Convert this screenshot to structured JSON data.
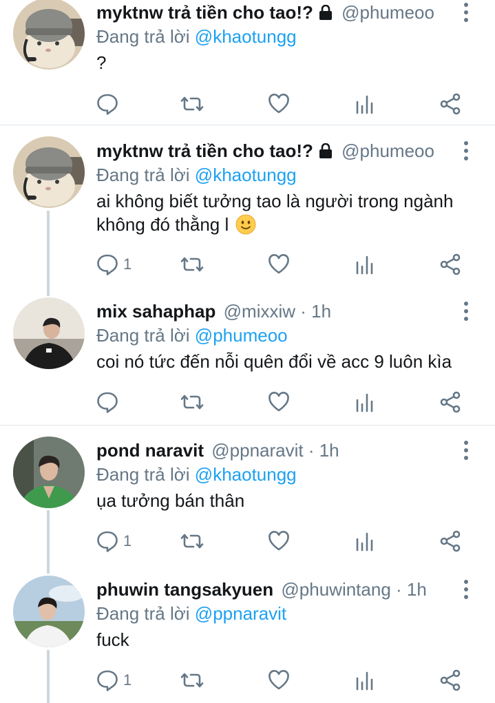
{
  "reply_prefix": "Đang trả lời",
  "colors": {
    "accent": "#1da1f2",
    "muted": "#657786",
    "icon": "#657786",
    "divider": "#e1e8ed",
    "thread": "#ccd6dd"
  },
  "tweets": [
    {
      "name": "myktnw trả tiền cho tao!?",
      "handle": "@phumeoo",
      "time": "",
      "locked": true,
      "avatar_icon": "cat-beanie-avatar",
      "reply_to": "@khaotungg",
      "text": "?",
      "reply_count": "",
      "emoji": ""
    },
    {
      "name": "myktnw trả tiền cho tao!?",
      "handle": "@phumeoo",
      "time": "",
      "locked": true,
      "avatar_icon": "cat-beanie-avatar",
      "reply_to": "@khaotungg",
      "text": "ai không biết tưởng tao là người trong ngành không đó thằng l",
      "reply_count": "1",
      "emoji": "slightly-smiling-face"
    },
    {
      "name": "mix sahaphap",
      "handle": "@mixxiw",
      "time": "· 1h",
      "locked": false,
      "avatar_icon": "person-avatar",
      "reply_to": "@phumeoo",
      "text": "coi nó tức đến nỗi quên đổi về acc 9 luôn kìa",
      "reply_count": "",
      "emoji": ""
    },
    {
      "name": "pond naravit",
      "handle": "@ppnaravit",
      "time": "· 1h",
      "locked": false,
      "avatar_icon": "person-avatar",
      "reply_to": "@khaotungg",
      "text": "ụa tưởng bán thân",
      "reply_count": "1",
      "emoji": ""
    },
    {
      "name": "phuwin tangsakyuen",
      "handle": "@phuwintang",
      "time": "· 1h",
      "locked": false,
      "avatar_icon": "person-avatar",
      "reply_to": "@ppnaravit",
      "text": "fuck",
      "reply_count": "1",
      "emoji": ""
    }
  ]
}
